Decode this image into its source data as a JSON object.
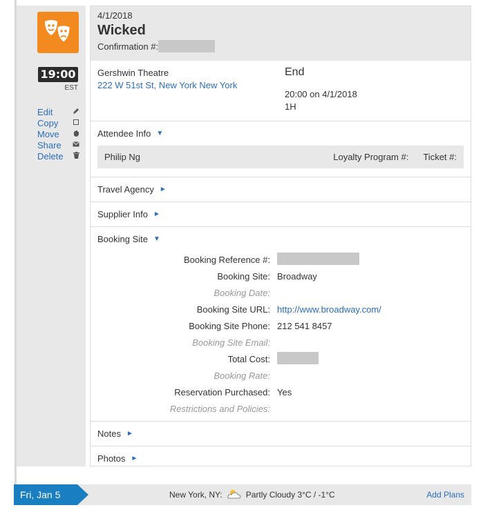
{
  "event": {
    "date": "4/1/2018",
    "title": "Wicked",
    "confirmation_label": "Confirmation #:",
    "start_time": "19:00",
    "time_zone": "EST",
    "icon": "theater-masks-icon",
    "accent": "#f28a1f"
  },
  "actions": [
    {
      "label": "Edit",
      "icon": "pencil-icon"
    },
    {
      "label": "Copy",
      "icon": "copy-icon"
    },
    {
      "label": "Move",
      "icon": "hand-icon"
    },
    {
      "label": "Share",
      "icon": "envelope-icon"
    },
    {
      "label": "Delete",
      "icon": "trash-icon"
    }
  ],
  "location": {
    "venue": "Gershwin Theatre",
    "address": "222 W 51st St, New York New York",
    "end_label": "End",
    "end_time": "20:00 on 4/1/2018",
    "duration": "1H"
  },
  "sections": {
    "attendee": "Attendee Info",
    "travel_agency": "Travel Agency",
    "supplier": "Supplier Info",
    "booking": "Booking Site",
    "notes": "Notes",
    "photos": "Photos"
  },
  "attendee": {
    "name": "Philip Ng",
    "loyalty_label": "Loyalty Program #:",
    "ticket_label": "Ticket #:"
  },
  "booking": {
    "reference_label": "Booking Reference #:",
    "site_label": "Booking Site:",
    "site_value": "Broadway",
    "date_label": "Booking Date:",
    "url_label": "Booking Site URL:",
    "url_value": "http://www.broadway.com/",
    "phone_label": "Booking Site Phone:",
    "phone_value": "212 541 8457",
    "email_label": "Booking Site Email:",
    "cost_label": "Total Cost:",
    "rate_label": "Booking Rate:",
    "purchased_label": "Reservation Purchased:",
    "purchased_value": "Yes",
    "policies_label": "Restrictions and Policies:"
  },
  "footer": {
    "day": "Fri, Jan 5",
    "location": "New York, NY:",
    "weather": "Partly Cloudy 3°C / -1°C",
    "add_plans": "Add Plans",
    "accent": "#1a7fc1"
  }
}
